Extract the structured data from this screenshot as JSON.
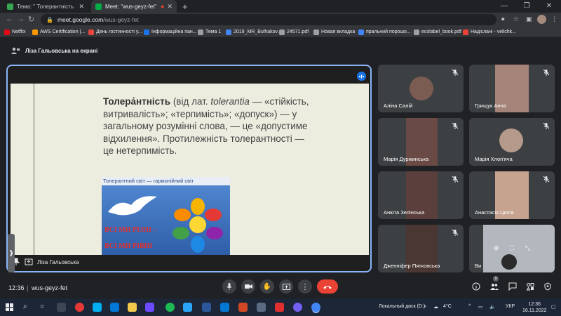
{
  "browser": {
    "tabs": [
      {
        "title": "Тема: \" Толерантність :Ми- різні",
        "active": false
      },
      {
        "title": "Meet: \"wus-geyz-fet\"",
        "active": true
      }
    ],
    "new_tab": "+",
    "window_controls": {
      "minimize": "—",
      "maximize": "❐",
      "close": "✕"
    },
    "url_host": "meet.google.com",
    "url_path": "/wus-geyz-fet",
    "bookmarks": [
      {
        "label": "Netflix",
        "color": "#e50914"
      },
      {
        "label": "AWS Certification |...",
        "color": "#ff9900"
      },
      {
        "label": "День гостинності у...",
        "color": "#e8453c"
      },
      {
        "label": "Інформаційна пан...",
        "color": "#1a73e8"
      },
      {
        "label": "Тема 1",
        "color": "#9aa0a6"
      },
      {
        "label": "2019_MR_Bulhakov...",
        "color": "#4285f4"
      },
      {
        "label": "24571.pdf",
        "color": "#9aa0a6"
      },
      {
        "label": "Новая вкладка",
        "color": "#9aa0a6"
      },
      {
        "label": "пральний порошо...",
        "color": "#4285f4"
      },
      {
        "label": "ecolabel_book.pdf",
        "color": "#9aa0a6"
      },
      {
        "label": "Надіслані - velichk...",
        "color": "#ea4335"
      }
    ]
  },
  "meet": {
    "presenting_label": "Ліза Гальовська на екрані",
    "presenter_name": "Ліза Гальовська",
    "slide": {
      "term": "Толера́нтність",
      "text_1": " (від лат. ",
      "latin": "tolerantia",
      "text_2": " — «стійкість, витривалість»; «терпимість»; «допуск») — у загальному розумінні слова, — це «допустиме відхилення». Протилежність толерантності — це нетерпимість.",
      "pic_caption": "Толерантний світ — гармонійний світ",
      "pic_line1": "ВСІ МИ РІЗНІ –",
      "pic_line2": "ВСІ МИ РІВНІ"
    },
    "participants": [
      {
        "name": "Аліна Салій"
      },
      {
        "name": "Грищук Анна"
      },
      {
        "name": "Марія Дуржинська"
      },
      {
        "name": "Марія Хлоп'яча"
      },
      {
        "name": "Анюта Зелінська"
      },
      {
        "name": "Анастасія Цюпа"
      },
      {
        "name": "Дженніфер Пятковська"
      },
      {
        "name": "Ви"
      }
    ],
    "time": "12:36",
    "meeting_code": "wus-geyz-fet",
    "people_count": "9",
    "end_call_color": "#ea4335",
    "accent": "#8ab4f8"
  },
  "taskbar": {
    "disk_label": "Локальный диск (D:)",
    "temperature": "4°C",
    "language": "УКР",
    "time": "12:36",
    "date": "16.11.2022"
  }
}
